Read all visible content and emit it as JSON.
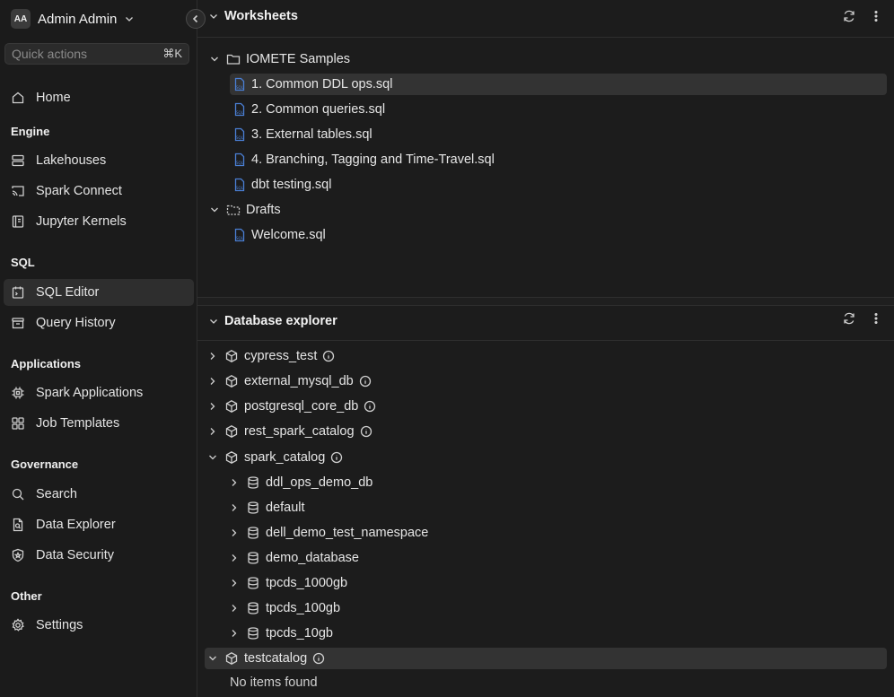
{
  "user": {
    "initials": "AA",
    "name": "Admin Admin"
  },
  "quick_actions": {
    "placeholder": "Quick actions",
    "shortcut": "⌘K"
  },
  "nav": {
    "home": "Home",
    "engine": {
      "label": "Engine",
      "items": [
        "Lakehouses",
        "Spark Connect",
        "Jupyter Kernels"
      ]
    },
    "sql": {
      "label": "SQL",
      "items": [
        "SQL Editor",
        "Query History"
      ]
    },
    "applications": {
      "label": "Applications",
      "items": [
        "Spark Applications",
        "Job Templates"
      ]
    },
    "governance": {
      "label": "Governance",
      "items": [
        "Search",
        "Data Explorer",
        "Data Security"
      ]
    },
    "other": {
      "label": "Other",
      "items": [
        "Settings"
      ]
    }
  },
  "worksheets": {
    "title": "Worksheets",
    "folders": [
      {
        "name": "IOMETE Samples",
        "files": [
          "1. Common DDL ops.sql",
          "2. Common queries.sql",
          "3. External tables.sql",
          "4. Branching, Tagging and Time-Travel.sql",
          "dbt testing.sql"
        ]
      },
      {
        "name": "Drafts",
        "files": [
          "Welcome.sql"
        ]
      }
    ]
  },
  "database_explorer": {
    "title": "Database explorer",
    "catalogs": [
      "cypress_test",
      "external_mysql_db",
      "postgresql_core_db",
      "rest_spark_catalog",
      "spark_catalog",
      "testcatalog"
    ],
    "spark_catalog_databases": [
      "ddl_ops_demo_db",
      "default",
      "dell_demo_test_namespace",
      "demo_database",
      "tpcds_1000gb",
      "tpcds_100gb",
      "tpcds_10gb"
    ],
    "empty_message": "No items found"
  },
  "colors": {
    "background": "#1c1c1c",
    "selected": "#333333",
    "sql_icon": "#4a7fd4"
  }
}
